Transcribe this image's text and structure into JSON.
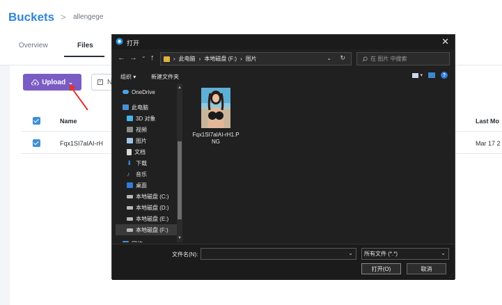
{
  "app": {
    "title": "Buckets",
    "breadcrumb_sep": ">",
    "breadcrumb": "allengege",
    "tabs": [
      {
        "label": "Overview"
      },
      {
        "label": "Files",
        "active": true
      }
    ],
    "upload_label": "Upload",
    "newfolder_label": "N",
    "table": {
      "col_name": "Name",
      "col_last": "Last Mo",
      "row": {
        "name": "Fqx1SI7aIAI-rH",
        "date": "Mar 17 2"
      }
    },
    "colors": {
      "brand": "#2f86d6",
      "upload_button": "#7b5cc4",
      "annotation_arrow": "#e2332a"
    }
  },
  "dialog": {
    "title": "打开",
    "close": "✕",
    "nav": {
      "back": "←",
      "forward": "→",
      "recent": "⌄",
      "up": "↑"
    },
    "address": {
      "parts": [
        "此电脑",
        "本地磁盘 (F:)",
        "图片"
      ],
      "sep": "›",
      "dropdown": "⌄",
      "refresh": "↻"
    },
    "search_placeholder": "在 图片 中搜索",
    "toolbar": {
      "organize": "组织 ▾",
      "new_folder": "新建文件夹",
      "help": "?"
    },
    "sidebar": [
      {
        "label": "OneDrive",
        "icon": "cloud-icon"
      },
      {
        "label": "此电脑",
        "icon": "computer-icon"
      },
      {
        "label": "3D 对象",
        "icon": "3d-objects-icon"
      },
      {
        "label": "视频",
        "icon": "video-icon"
      },
      {
        "label": "图片",
        "icon": "pictures-icon"
      },
      {
        "label": "文档",
        "icon": "documents-icon"
      },
      {
        "label": "下载",
        "icon": "download-icon"
      },
      {
        "label": "音乐",
        "icon": "music-icon"
      },
      {
        "label": "桌面",
        "icon": "desktop-icon"
      },
      {
        "label": "本地磁盘 (C:)",
        "icon": "drive-icon"
      },
      {
        "label": "本地磁盘 (D:)",
        "icon": "drive-icon"
      },
      {
        "label": "本地磁盘 (E:)",
        "icon": "drive-icon"
      },
      {
        "label": "本地磁盘 (F:)",
        "icon": "drive-icon",
        "selected": true
      },
      {
        "label": "网络",
        "icon": "network-icon"
      }
    ],
    "files": [
      {
        "name": "Fqx1SI7aIAI-rH1.PNG"
      }
    ],
    "filename_label": "文件名(N):",
    "filename_value": "",
    "filetype": "所有文件 (*.*)",
    "open_label": "打开(O)",
    "cancel_label": "取消"
  }
}
